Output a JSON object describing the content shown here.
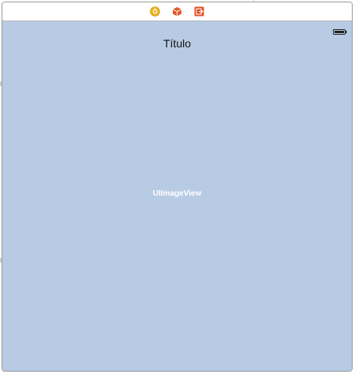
{
  "scene": {
    "dock": {
      "icons": [
        "view-controller-icon",
        "first-responder-icon",
        "exit-icon"
      ]
    },
    "status_bar": {
      "battery_icon": "battery-icon"
    },
    "title_label": "Título",
    "image_view_label": "UIImageView"
  },
  "colors": {
    "view_background": "#b8cbe5",
    "view_controller_icon": "#e8b41e",
    "first_responder_icon": "#e25a2b",
    "exit_icon": "#e2532a"
  }
}
